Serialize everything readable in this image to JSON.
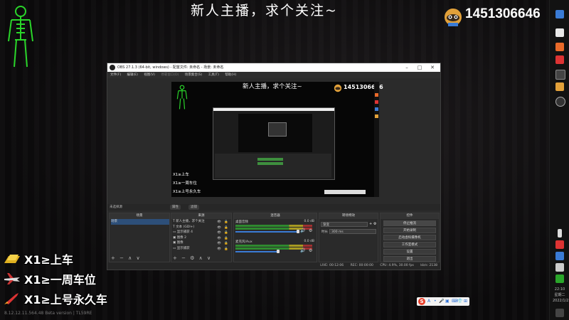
{
  "stream_overlay": {
    "title": "新人主播，求个关注~",
    "room_id": "1451306646",
    "notices": [
      {
        "text": "X1≥上车",
        "icon": "gold-bar-icon"
      },
      {
        "text": "X1≥一周车位",
        "icon": "airplane-icon"
      },
      {
        "text": "X1≥上号永久车",
        "icon": "rocket-icon"
      }
    ],
    "version_text": "8.12.12.11.564.48 Beta version | TL59RE"
  },
  "obs_window": {
    "title": "OBS 27.1.3 (64-bit, windows) - 配置文件: 未命名 - 场景: 未命名",
    "controls": [
      "–",
      "□",
      "✕"
    ],
    "menu": [
      "文件(F)",
      "编辑(E)",
      "视图(V)",
      "停靠窗口(D)",
      "场景集合(S)",
      "工具(T)",
      "帮助(H)"
    ],
    "preview": {
      "title": "新人主播，求个关注~",
      "room_id": "1451306646",
      "lines": [
        "X1≥上车",
        "X1≥一周车位",
        "X1≥上号永久车"
      ]
    },
    "source_bar": {
      "label": "未选择源",
      "properties_button": "属性",
      "filters_button": "滤镜"
    },
    "scenes_dock": {
      "header": "场景",
      "items": [
        "场景"
      ],
      "footer": "+ − ∧ ∨"
    },
    "sources_dock": {
      "header": "来源",
      "items": [
        {
          "name": "新人主播，求个关注",
          "icon": "text-icon"
        },
        {
          "name": "文本 (GDI+)",
          "icon": "text-icon"
        },
        {
          "name": "显示捕获 4",
          "icon": "display-capture-icon"
        },
        {
          "name": "图像 2",
          "icon": "image-icon"
        },
        {
          "name": "图像",
          "icon": "image-icon"
        },
        {
          "name": "显示捕获",
          "icon": "display-capture-icon"
        }
      ],
      "footer": "+ − ⚙ ∧ ∨"
    },
    "mixer_dock": {
      "header": "混音器",
      "channels": [
        {
          "name": "桌面音频",
          "db": "0.0 dB"
        },
        {
          "name": "麦克风/Aux",
          "db": "0.0 dB"
        }
      ]
    },
    "transitions_dock": {
      "header": "转场特效",
      "type": "渐变",
      "duration_label": "时长",
      "duration": "300 ms"
    },
    "controls_dock": {
      "header": "控件",
      "buttons": [
        "停止推流",
        "开始录制",
        "启动虚拟摄像机",
        "工作室模式",
        "设置",
        "退出"
      ]
    },
    "status": {
      "live": "LIVE: 00:12:06",
      "rec": "REC: 00:00:00",
      "cpu": "CPU: 4.9%, 30.00 fps",
      "kbps": "kb/s: 2138"
    }
  },
  "taskbar": {
    "time": "22:10",
    "weekday": "星期二",
    "date": "2022/1/25"
  },
  "ime": {
    "logo": "S",
    "items": [
      "A",
      "•",
      "🎤",
      "▣",
      "⌨",
      "👕",
      "⊞"
    ]
  },
  "colors": {
    "accent_blue": "#3a7bd5",
    "meter_green": "#2f8a2f",
    "figure_green": "#2ad62a",
    "selection": "#2d4f79"
  }
}
